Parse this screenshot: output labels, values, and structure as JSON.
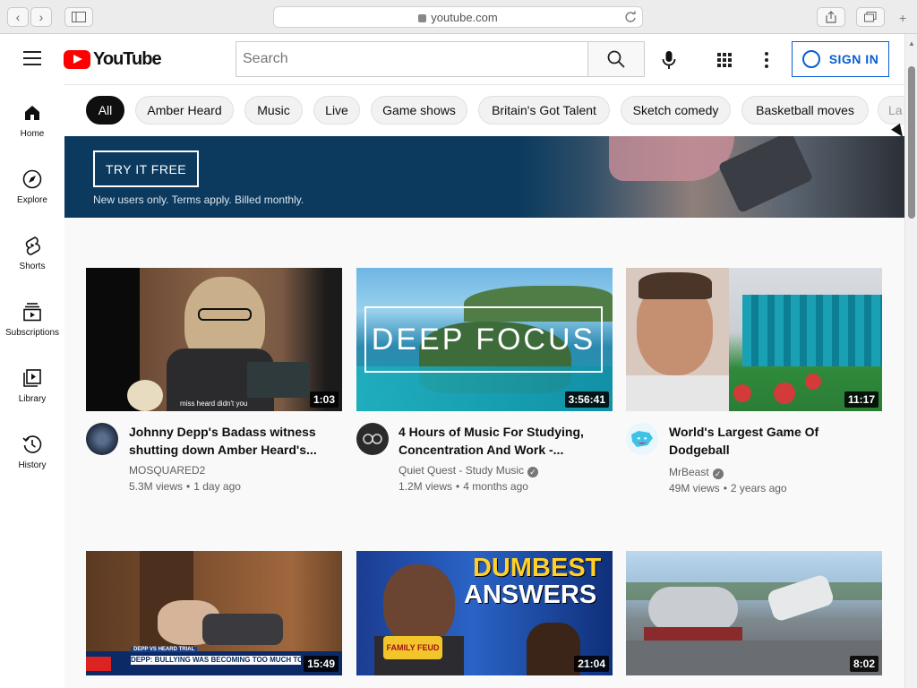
{
  "browser": {
    "url": "youtube.com"
  },
  "header": {
    "logo_text": "YouTube",
    "search_placeholder": "Search",
    "signin_label": "SIGN IN"
  },
  "sidebar": {
    "items": [
      {
        "label": "Home",
        "icon": "home-icon"
      },
      {
        "label": "Explore",
        "icon": "compass-icon"
      },
      {
        "label": "Shorts",
        "icon": "shorts-icon"
      },
      {
        "label": "Subscriptions",
        "icon": "subscriptions-icon"
      },
      {
        "label": "Library",
        "icon": "library-icon"
      },
      {
        "label": "History",
        "icon": "history-icon"
      }
    ]
  },
  "chips": [
    "All",
    "Amber Heard",
    "Music",
    "Live",
    "Game shows",
    "Britain's Got Talent",
    "Sketch comedy",
    "Basketball moves",
    "La"
  ],
  "banner": {
    "button_label": "TRY IT FREE",
    "note": "New users only. Terms apply. Billed monthly."
  },
  "videos": [
    {
      "title_line1": "Johnny Depp's Badass witness",
      "title_line2": "shutting down Amber Heard's...",
      "channel": "MOSQUARED2",
      "views": "5.3M views",
      "age": "1 day ago",
      "duration": "1:03",
      "verified": false,
      "caption": "miss heard didn't you"
    },
    {
      "title_line1": "4 Hours of Music For Studying,",
      "title_line2": "Concentration And Work -...",
      "channel": "Quiet Quest - Study Music",
      "views": "1.2M views",
      "age": "4 months ago",
      "duration": "3:56:41",
      "verified": true,
      "overlay": "DEEP FOCUS"
    },
    {
      "title_line1": "World's Largest Game Of",
      "title_line2": "Dodgeball",
      "channel": "MrBeast",
      "views": "49M views",
      "age": "2 years ago",
      "duration": "11:17",
      "verified": true
    },
    {
      "duration": "15:49",
      "ticker_top": "DEPP VS HEARD TRIAL",
      "ticker": "DEPP: BULLYING WAS BECOMING TOO MUCH TO TAKE"
    },
    {
      "duration": "21:04",
      "overlay_line1": "DUMBEST",
      "overlay_line2": "ANSWERS",
      "sign": "FAMILY FEUD"
    },
    {
      "duration": "8:02"
    }
  ],
  "colors": {
    "brand_red": "#ff0000",
    "link_blue": "#065fd4",
    "banner_bg": "#0b3a5e"
  }
}
